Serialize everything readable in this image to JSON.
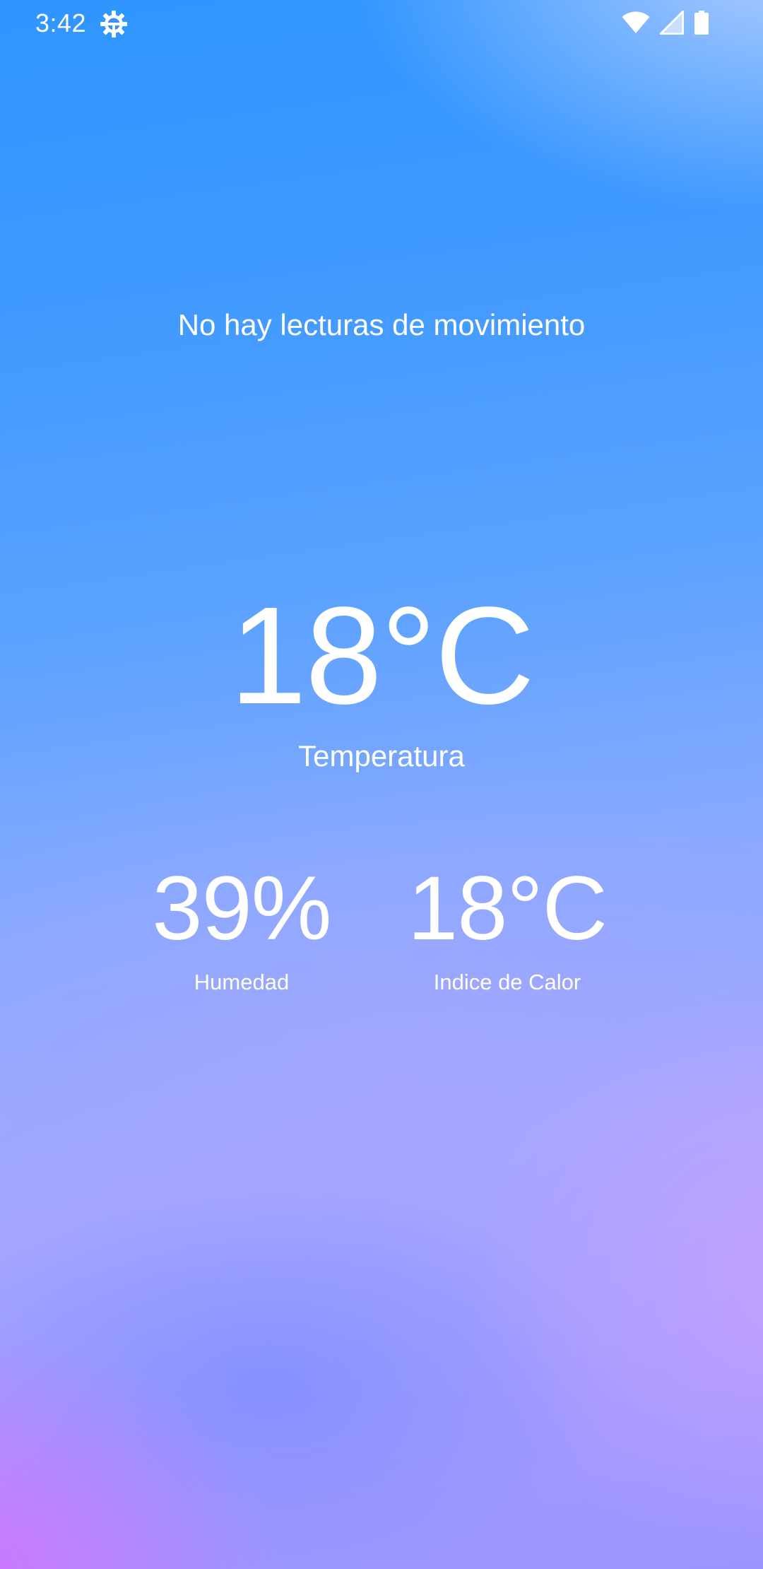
{
  "status_bar": {
    "time": "3:42",
    "left_icon": "settings-icon",
    "right_icons": [
      "wifi-icon",
      "cellular-signal-icon",
      "battery-icon"
    ]
  },
  "motion": {
    "message": "No hay lecturas de movimiento"
  },
  "temperature": {
    "value": "18°C",
    "label": "Temperatura"
  },
  "humidity": {
    "value": "39%",
    "label": "Humedad"
  },
  "heat_index": {
    "value": "18°C",
    "label": "Indice de Calor"
  },
  "colors": {
    "text": "#ffffff",
    "gradient_top": "#2f95ff",
    "gradient_bottom": "#9b94ff",
    "accent_pink": "#d76eff"
  }
}
